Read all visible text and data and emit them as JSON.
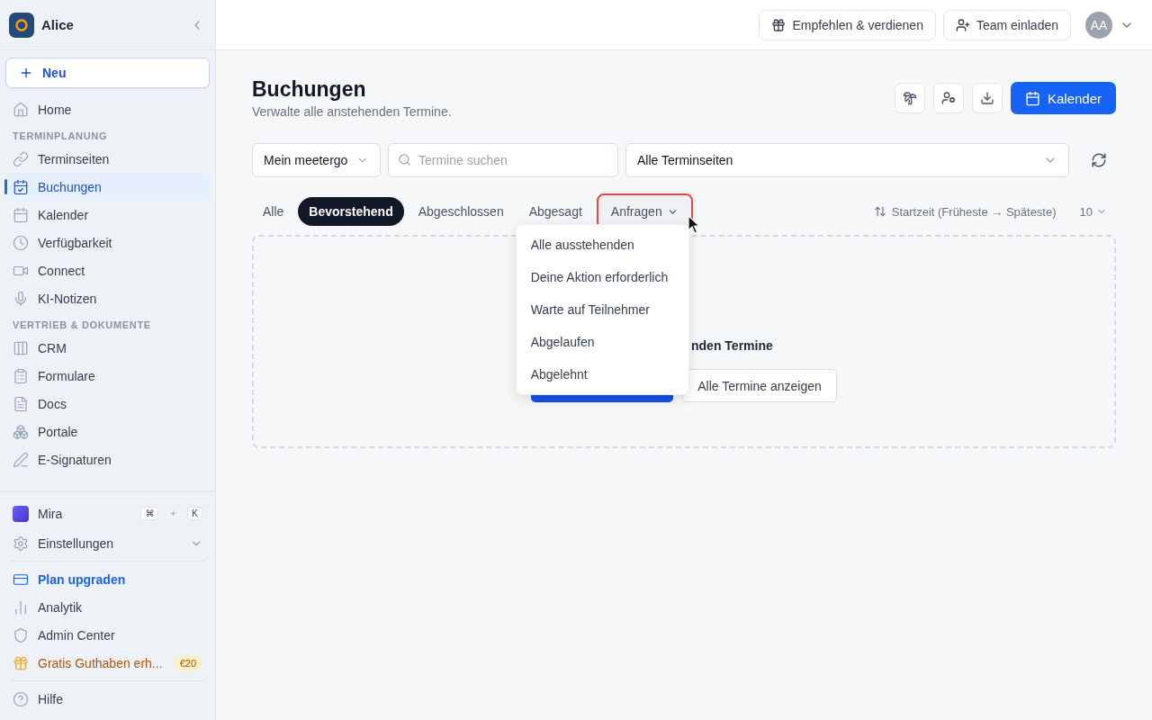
{
  "sidebar": {
    "workspace": "Alice",
    "new_button": "Neu",
    "nav": [
      {
        "kind": "link",
        "label": "Home",
        "selected": false
      },
      {
        "kind": "heading",
        "label": "TERMINPLANUNG"
      },
      {
        "kind": "link",
        "label": "Terminseiten",
        "selected": false
      },
      {
        "kind": "link",
        "label": "Buchungen",
        "selected": true
      },
      {
        "kind": "link",
        "label": "Kalender",
        "selected": false
      },
      {
        "kind": "link",
        "label": "Verfügbarkeit",
        "selected": false
      },
      {
        "kind": "link",
        "label": "Connect",
        "selected": false
      },
      {
        "kind": "link",
        "label": "KI-Notizen",
        "selected": false
      },
      {
        "kind": "heading",
        "label": "VERTRIEB & DOKUMENTE"
      },
      {
        "kind": "link",
        "label": "CRM",
        "selected": false
      },
      {
        "kind": "link",
        "label": "Formulare",
        "selected": false
      },
      {
        "kind": "link",
        "label": "Docs",
        "selected": false
      },
      {
        "kind": "link",
        "label": "Portale",
        "selected": false
      },
      {
        "kind": "link",
        "label": "E-Signaturen",
        "selected": false
      }
    ],
    "assistant": {
      "label": "Mira",
      "keys": [
        "⌘",
        "K"
      ],
      "joiner": "+"
    },
    "settings": {
      "label": "Einstellungen",
      "expanded": false
    },
    "footer": [
      {
        "kind": "upgrade",
        "label": "Plan upgraden"
      },
      {
        "kind": "link",
        "label": "Analytik"
      },
      {
        "kind": "link",
        "label": "Admin Center"
      },
      {
        "kind": "promo",
        "label": "Gratis Guthaben erh...",
        "badge": "€20"
      }
    ],
    "help": "Hilfe"
  },
  "topbar": {
    "buttons": [
      "Empfehlen & verdienen",
      "Team einladen"
    ],
    "avatar": "AA"
  },
  "header": {
    "title": "Buchungen",
    "subtitle": "Verwalte alle anstehenden Termine.",
    "primary_button": "Kalender"
  },
  "filters": {
    "scope": "Mein meetergo",
    "search": {
      "placeholder": "Termine suchen"
    },
    "pages": "Alle Terminseiten"
  },
  "tabs": [
    {
      "kind": "tab",
      "label": "Alle",
      "selected": false
    },
    {
      "kind": "tab",
      "label": "Bevorstehend",
      "selected": true
    },
    {
      "kind": "tab",
      "label": "Abgeschlossen",
      "selected": false
    },
    {
      "kind": "tab",
      "label": "Abgesagt",
      "selected": false
    },
    {
      "kind": "dropdown",
      "label": "Anfragen",
      "selected": false,
      "expanded": true
    }
  ],
  "sort": "Startzeit (Früheste → Späteste)",
  "page_size": "10",
  "dropdown_menu": [
    "Alle ausstehenden",
    "Deine Aktion erforderlich",
    "Warte auf Teilnehmer",
    "Abgelaufen",
    "Abgelehnt"
  ],
  "empty_state": {
    "message": "nden Termine",
    "secondary_button": "Alle Termine anzeigen"
  }
}
